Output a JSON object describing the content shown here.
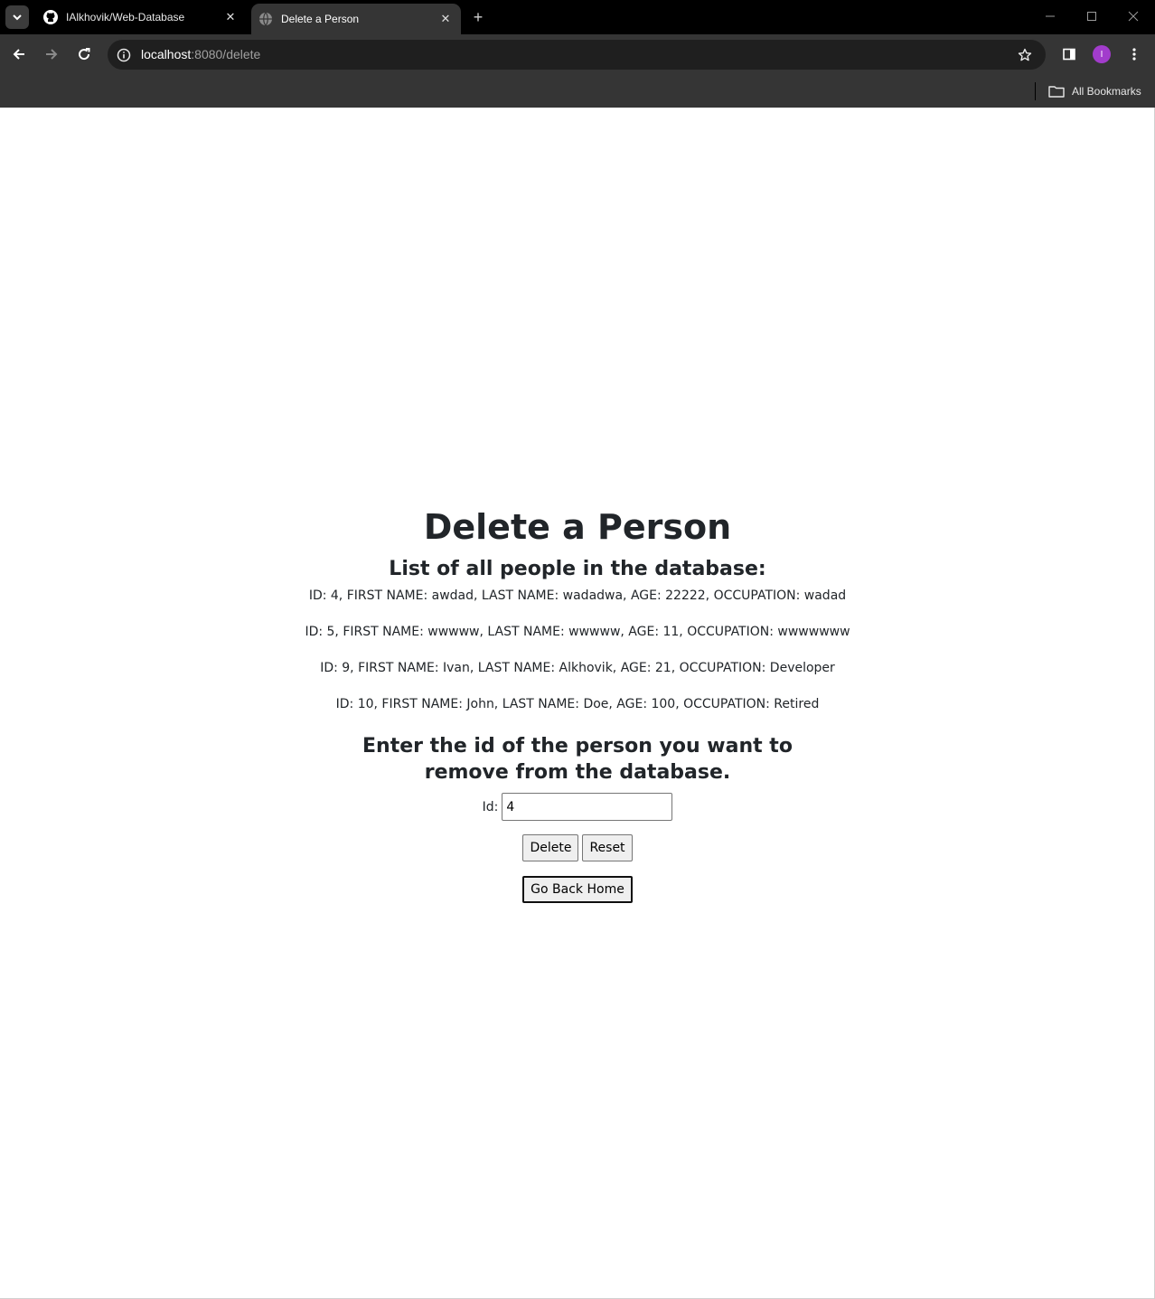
{
  "browser": {
    "tabs": [
      {
        "title": "IAlkhovik/Web-Database",
        "icon": "github-icon",
        "active": false
      },
      {
        "title": "Delete a Person",
        "icon": "globe-icon",
        "active": true
      }
    ],
    "url_host": "localhost",
    "url_path": ":8080/delete",
    "profile_initial": "I",
    "bookmarks_label": "All Bookmarks"
  },
  "page": {
    "title": "Delete a Person",
    "list_heading": "List of all people in the database:",
    "people": [
      "ID: 4, FIRST NAME: awdad, LAST NAME: wadadwa, AGE: 22222, OCCUPATION: wadad",
      "ID: 5, FIRST NAME: wwwww, LAST NAME: wwwww, AGE: 11, OCCUPATION: wwwwwww",
      "ID: 9, FIRST NAME: Ivan, LAST NAME: Alkhovik, AGE: 21, OCCUPATION: Developer",
      "ID: 10, FIRST NAME: John, LAST NAME: Doe, AGE: 100, OCCUPATION: Retired"
    ],
    "prompt": "Enter the id of the person you want to remove from the database.",
    "id_label": "Id:",
    "id_value": "4",
    "delete_label": "Delete",
    "reset_label": "Reset",
    "home_label": "Go Back Home"
  },
  "colors": {
    "text": "#212529",
    "chrome_bg": "#000000",
    "toolbar_bg": "#353535",
    "avatar": "#a23ccc"
  }
}
